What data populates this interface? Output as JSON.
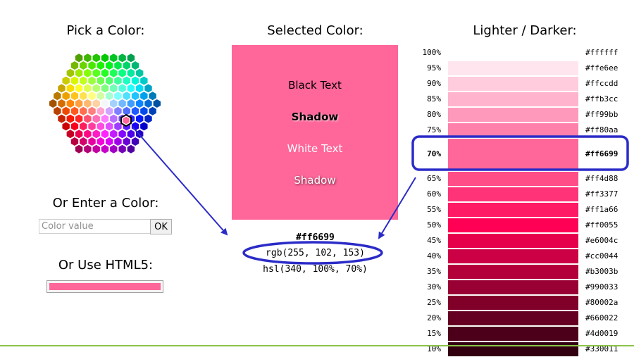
{
  "headings": {
    "pick": "Pick a Color:",
    "selected": "Selected Color:",
    "shades": "Lighter / Darker:",
    "enter": "Or Enter a Color:",
    "html5": "Or Use HTML5:"
  },
  "input": {
    "placeholder": "Color value",
    "value": "",
    "ok_label": "OK"
  },
  "selected_color": "#ff6699",
  "preview": {
    "black_text": "Black Text",
    "black_shadow": "Shadow",
    "white_text": "White Text",
    "white_shadow": "Shadow"
  },
  "values": {
    "hex": "#ff6699",
    "rgb": "rgb(255, 102, 153)",
    "hsl": "hsl(340, 100%, 70%)"
  },
  "shades": [
    {
      "pct": "100%",
      "hex": "#ffffff"
    },
    {
      "pct": "95%",
      "hex": "#ffe6ee"
    },
    {
      "pct": "90%",
      "hex": "#ffccdd"
    },
    {
      "pct": "85%",
      "hex": "#ffb3cc"
    },
    {
      "pct": "80%",
      "hex": "#ff99bb"
    },
    {
      "pct": "75%",
      "hex": "#ff80aa"
    },
    {
      "pct": "70%",
      "hex": "#ff6699",
      "selected": true
    },
    {
      "pct": "65%",
      "hex": "#ff4d88"
    },
    {
      "pct": "60%",
      "hex": "#ff3377"
    },
    {
      "pct": "55%",
      "hex": "#ff1a66"
    },
    {
      "pct": "50%",
      "hex": "#ff0055"
    },
    {
      "pct": "45%",
      "hex": "#e6004c"
    },
    {
      "pct": "40%",
      "hex": "#cc0044"
    },
    {
      "pct": "35%",
      "hex": "#b3003b"
    },
    {
      "pct": "30%",
      "hex": "#990033"
    },
    {
      "pct": "25%",
      "hex": "#80002a"
    },
    {
      "pct": "20%",
      "hex": "#660022"
    },
    {
      "pct": "15%",
      "hex": "#4d0019"
    },
    {
      "pct": "10%",
      "hex": "#330011"
    }
  ],
  "colors": {
    "annotation": "#2b2bc8",
    "accent_line": "#8bc34a"
  },
  "icons": {
    "palette": "hexagon-color-palette-icon"
  }
}
